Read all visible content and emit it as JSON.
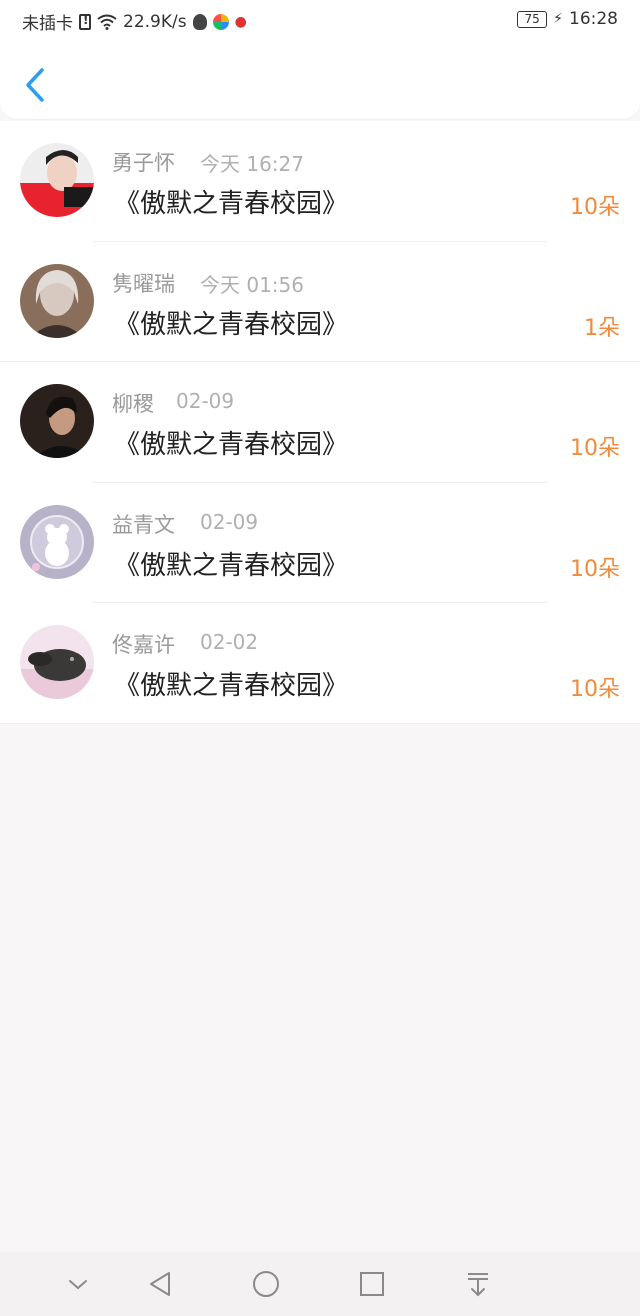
{
  "status_bar": {
    "carrier": "未插卡",
    "speed": "22.9K/s",
    "battery": "75",
    "time": "16:28"
  },
  "gifts": [
    {
      "name": "勇子怀",
      "time": "今天 16:27",
      "title": "《傲默之青春校园》",
      "amount": "10朵"
    },
    {
      "name": "隽曜瑞",
      "time": "今天 01:56",
      "title": "《傲默之青春校园》",
      "amount": "1朵"
    },
    {
      "name": "柳稷",
      "time": "02-09",
      "title": "《傲默之青春校园》",
      "amount": "10朵"
    },
    {
      "name": "益青文",
      "time": "02-09",
      "title": "《傲默之青春校园》",
      "amount": "10朵"
    },
    {
      "name": "佟嘉许",
      "time": "02-02",
      "title": "《傲默之青春校园》",
      "amount": "10朵"
    }
  ],
  "colors": {
    "accent": "#2a9ff0",
    "amount": "#f08a3c"
  }
}
